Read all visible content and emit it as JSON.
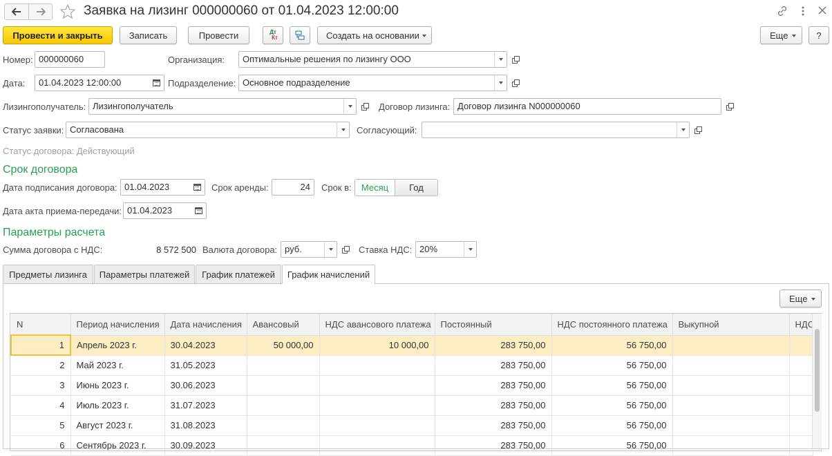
{
  "window": {
    "title": "Заявка на лизинг 000000060 от 01.04.2023 12:00:00"
  },
  "toolbar": {
    "post_close": "Провести и закрыть",
    "save": "Записать",
    "post": "Провести",
    "dt_kt": "Дт",
    "dt_kt_sub": "Кт",
    "create_based": "Создать на основании",
    "more": "Еще",
    "help": "?"
  },
  "form": {
    "number_label": "Номер:",
    "number": "000000060",
    "org_label": "Организация:",
    "org": "Оптимальные решения по лизингу ООО",
    "date_label": "Дата:",
    "date": "01.04.2023 12:00:00",
    "dept_label": "Подразделение:",
    "dept": "Основное подразделение",
    "lessee_label": "Лизингополучатель:",
    "lessee": "Лизингополучатель",
    "contract_label": "Договор лизинга:",
    "contract": "Договор лизинга N000000060",
    "status_label": "Статус заявки:",
    "status": "Согласована",
    "approver_label": "Согласующий:",
    "approver": "",
    "contract_status": "Статус договора: Действующий"
  },
  "term": {
    "section": "Срок договора",
    "sign_date_label": "Дата подписания договора:",
    "sign_date": "01.04.2023",
    "lease_term_label": "Срок аренды:",
    "lease_term": "24",
    "term_in_label": "Срок в:",
    "month": "Месяц",
    "year": "Год",
    "act_date_label": "Дата акта приема-передачи:",
    "act_date": "01.04.2023"
  },
  "calc": {
    "section": "Параметры расчета",
    "sum_label": "Сумма договора с НДС:",
    "sum": "8 572 500",
    "currency_label": "Валюта договора:",
    "currency": "руб.",
    "vat_label": "Ставка НДС:",
    "vat": "20%"
  },
  "tabs": [
    "Предметы лизинга",
    "Параметры платежей",
    "График платежей",
    "График начислений"
  ],
  "table": {
    "more": "Еще",
    "columns": [
      "N",
      "Период начисления",
      "Дата начисления",
      "Авансовый",
      "НДС авансового платежа",
      "Постоянный",
      "НДС постоянного платежа",
      "Выкупной",
      "НДС"
    ],
    "rows": [
      [
        "1",
        "Апрель 2023 г.",
        "30.04.2023",
        "50 000,00",
        "10 000,00",
        "283 750,00",
        "56 750,00",
        "",
        ""
      ],
      [
        "2",
        "Май 2023 г.",
        "31.05.2023",
        "",
        "",
        "283 750,00",
        "56 750,00",
        "",
        ""
      ],
      [
        "3",
        "Июнь 2023 г.",
        "30.06.2023",
        "",
        "",
        "283 750,00",
        "56 750,00",
        "",
        ""
      ],
      [
        "4",
        "Июль 2023 г.",
        "31.07.2023",
        "",
        "",
        "283 750,00",
        "56 750,00",
        "",
        ""
      ],
      [
        "5",
        "Август 2023 г.",
        "31.08.2023",
        "",
        "",
        "283 750,00",
        "56 750,00",
        "",
        ""
      ],
      [
        "6",
        "Сентябрь 2023 г.",
        "30.09.2023",
        "",
        "",
        "283 750,00",
        "56 750,00",
        "",
        ""
      ]
    ]
  },
  "colors": {
    "accent_green": "#23a24d",
    "primary_yellow": "#f5c800",
    "selected_row": "#fbeec3"
  }
}
